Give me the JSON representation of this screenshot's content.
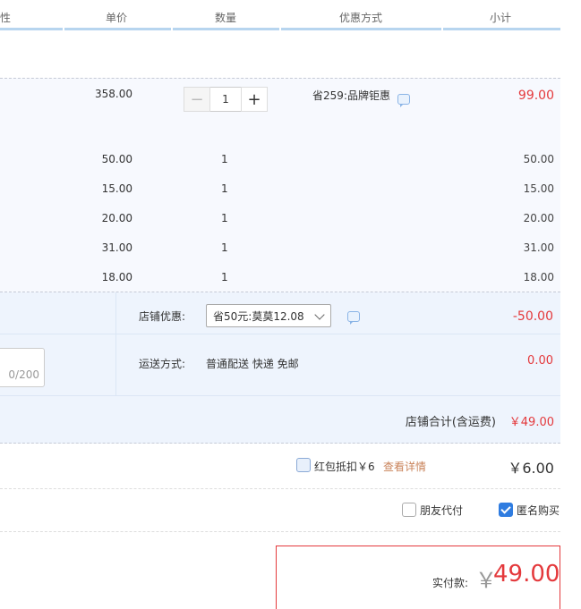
{
  "header": {
    "col_partial": "性",
    "unit_price": "单价",
    "quantity": "数量",
    "discount_method": "优惠方式",
    "subtotal": "小计"
  },
  "items": [
    {
      "price": "358.00",
      "qty": "1",
      "subtotal": "99.00",
      "promo": "省259:品牌钜惠"
    },
    {
      "price": "50.00",
      "qty": "1",
      "subtotal": "50.00"
    },
    {
      "price": "15.00",
      "qty": "1",
      "subtotal": "15.00"
    },
    {
      "price": "20.00",
      "qty": "1",
      "subtotal": "20.00"
    },
    {
      "price": "31.00",
      "qty": "1",
      "subtotal": "31.00"
    },
    {
      "price": "18.00",
      "qty": "1",
      "subtotal": "18.00"
    }
  ],
  "stepper": {
    "minus": "−",
    "plus": "+"
  },
  "shop": {
    "discount_label": "店铺优惠:",
    "discount_selected": "省50元:莫莫12.08",
    "discount_amount": "-50.00",
    "shipping_label": "运送方式:",
    "shipping_method": "普通配送 快递 免邮",
    "shipping_amount": "0.00",
    "memo_counter": "0/200",
    "total_label": "店铺合计(含运费)",
    "total_amount": "￥49.00"
  },
  "hongbao": {
    "label": "红包抵扣￥6",
    "link": "查看详情",
    "amount": "￥6.00"
  },
  "options": {
    "friend_pay": "朋友代付",
    "anonymous": "匿名购买"
  },
  "pay": {
    "label": "实付款:",
    "currency": "￥",
    "amount": "49.00"
  },
  "colors": {
    "accent_red": "#e4393c",
    "header_bar": "#b7d5ef",
    "checkbox_blue": "#2f7ce0"
  }
}
